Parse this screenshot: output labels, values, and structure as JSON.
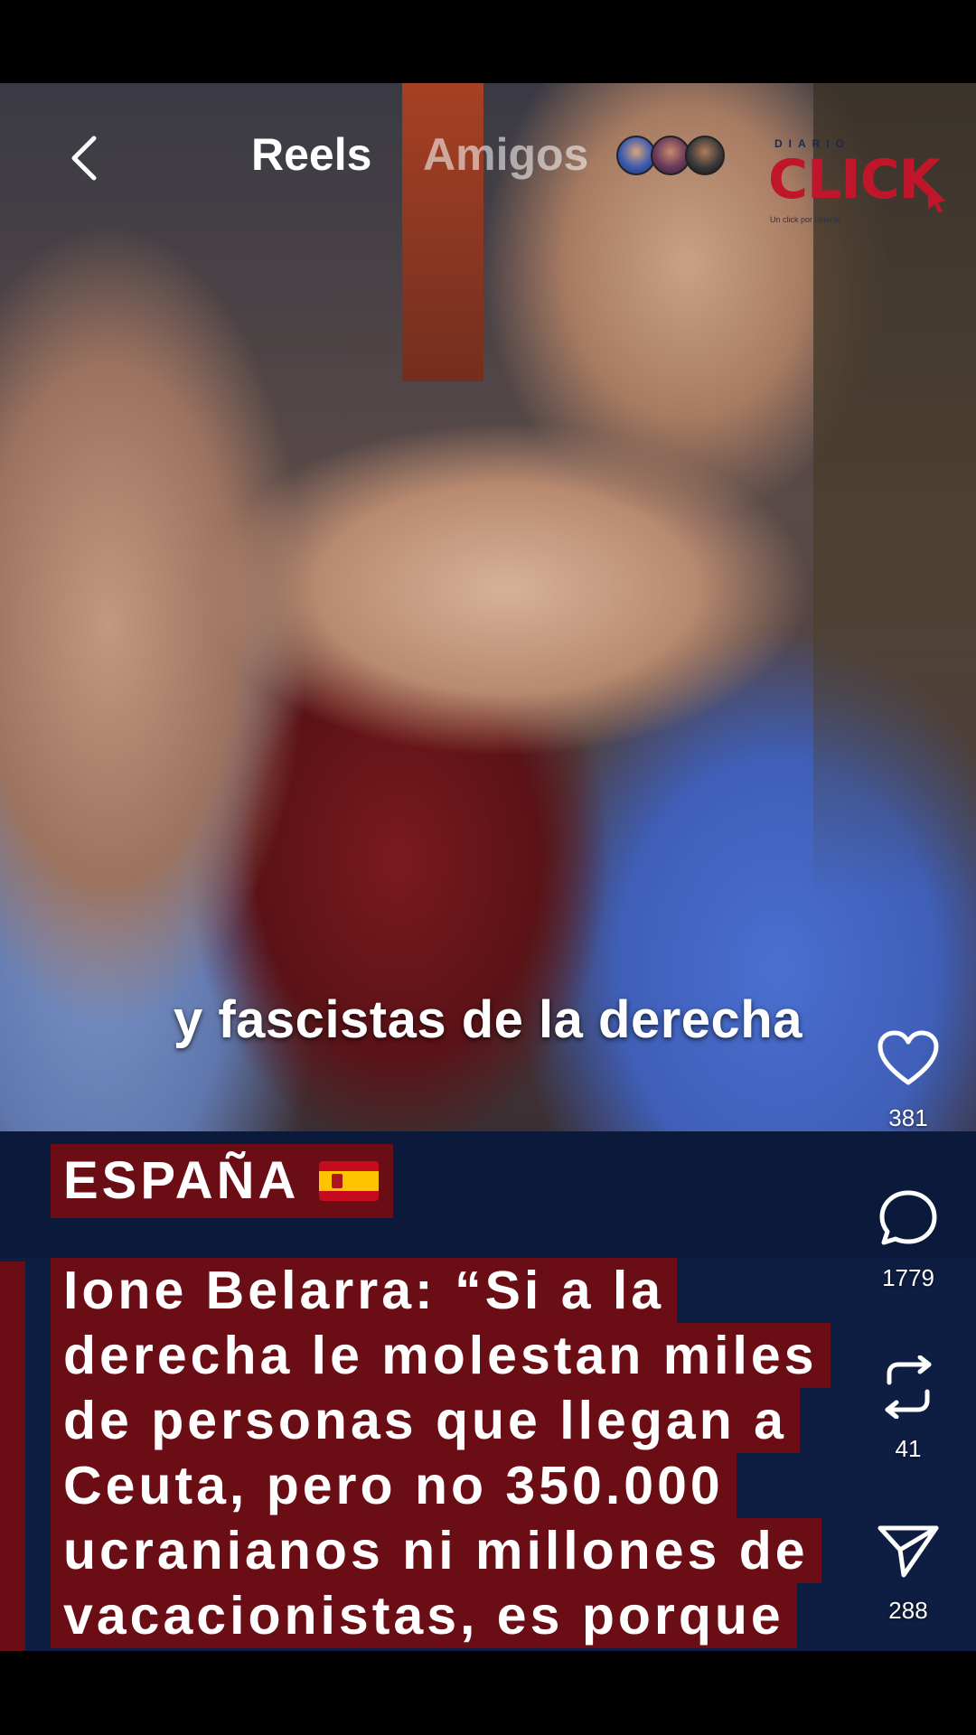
{
  "nav": {
    "tabs": [
      {
        "label": "Reels",
        "active": true
      },
      {
        "label": "Amigos",
        "active": false
      }
    ],
    "friend_avatars": [
      "avatar-1",
      "avatar-2",
      "avatar-3"
    ]
  },
  "logo": {
    "top_text": "DIARIO",
    "brand": "CLICK",
    "tagline": "Un click por delante"
  },
  "video": {
    "subtitle": "y fascistas de la derecha"
  },
  "caption": {
    "tag": "ESPAÑA",
    "flag_icon": "spain-flag-icon",
    "headline_lines": [
      "Ione Belarra: “Si a la",
      "derecha le molestan miles",
      "de personas que llegan a",
      "Ceuta, pero no 350.000",
      "ucranianos ni millones de",
      "vacacionistas, es porque"
    ]
  },
  "actions": {
    "likes": "381",
    "comments": "1779",
    "reposts": "41",
    "shares": "288"
  },
  "colors": {
    "tag_background": "#6b0d14",
    "caption_background": "#0b1a3a",
    "logo_red": "#c0162b",
    "logo_navy": "#1b2a4a"
  }
}
